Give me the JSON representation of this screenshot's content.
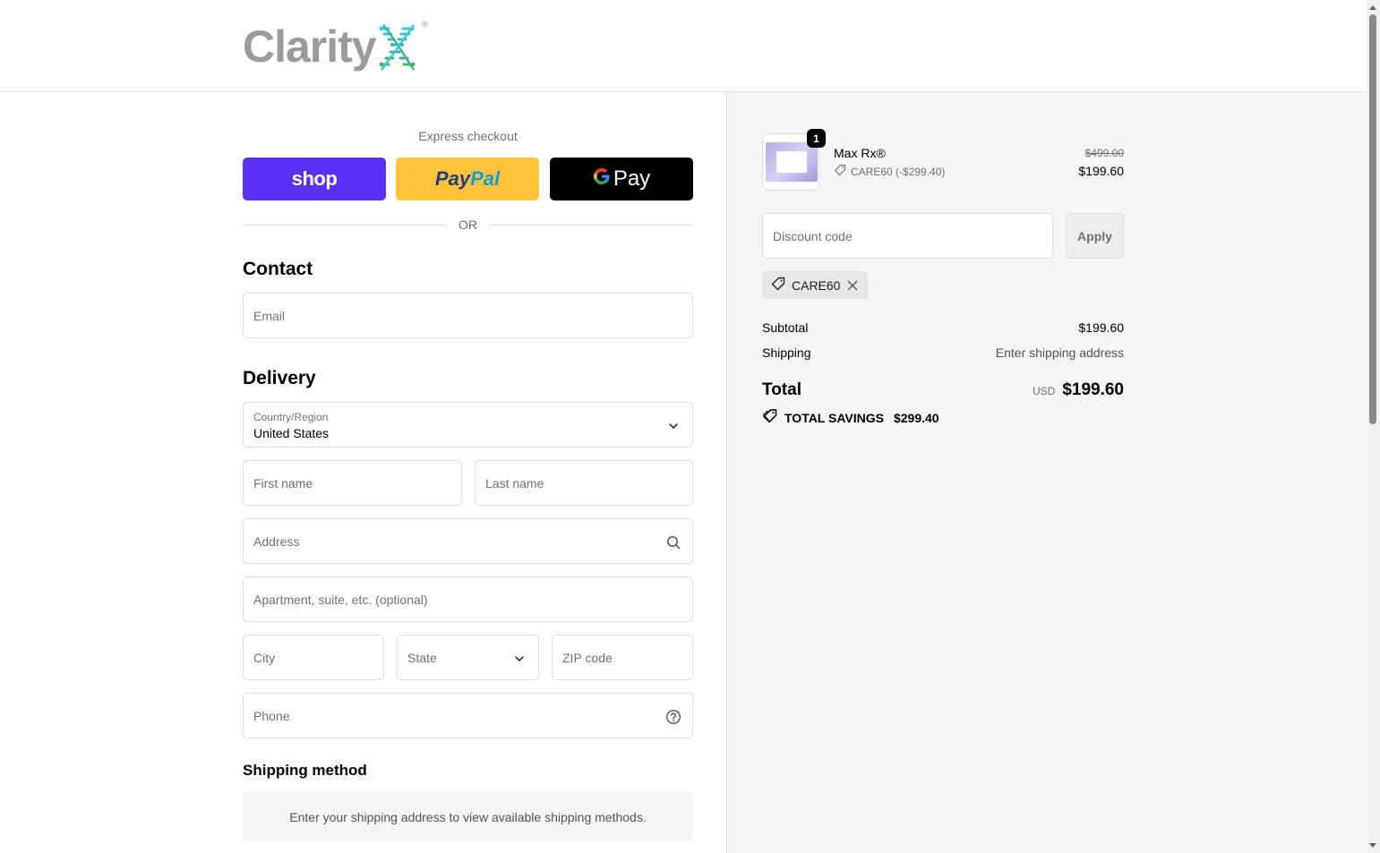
{
  "header": {
    "logo_text": "Clarity",
    "logo_reg": "®"
  },
  "express": {
    "label": "Express checkout",
    "shop_label": "shop",
    "paypal_part1": "Pay",
    "paypal_part2": "Pal",
    "gpay_g": "G",
    "gpay_label": "Pay",
    "or_text": "OR"
  },
  "contact": {
    "title": "Contact",
    "email_placeholder": "Email"
  },
  "delivery": {
    "title": "Delivery",
    "country_label": "Country/Region",
    "country_value": "United States",
    "first_name_placeholder": "First name",
    "last_name_placeholder": "Last name",
    "address_placeholder": "Address",
    "apartment_placeholder": "Apartment, suite, etc. (optional)",
    "city_placeholder": "City",
    "state_placeholder": "State",
    "zip_placeholder": "ZIP code",
    "phone_placeholder": "Phone"
  },
  "shipping_method": {
    "title": "Shipping method",
    "message": "Enter your shipping address to view available shipping methods."
  },
  "summary": {
    "product": {
      "quantity": "1",
      "name": "Max Rx®",
      "discount": "CARE60 (-$299.40)",
      "price_old": "$499.00",
      "price_new": "$199.60"
    },
    "discount_placeholder": "Discount code",
    "apply_label": "Apply",
    "applied_code": "CARE60",
    "subtotal_label": "Subtotal",
    "subtotal_value": "$199.60",
    "shipping_label": "Shipping",
    "shipping_value": "Enter shipping address",
    "total_label": "Total",
    "total_currency": "USD",
    "total_value": "$199.60",
    "savings_label": "TOTAL SAVINGS",
    "savings_value": "$299.40"
  },
  "colors": {
    "shop": "#5a31f4",
    "paypal": "#ffc439",
    "gpay": "#000000",
    "summary_bg": "#f5f5f5"
  }
}
